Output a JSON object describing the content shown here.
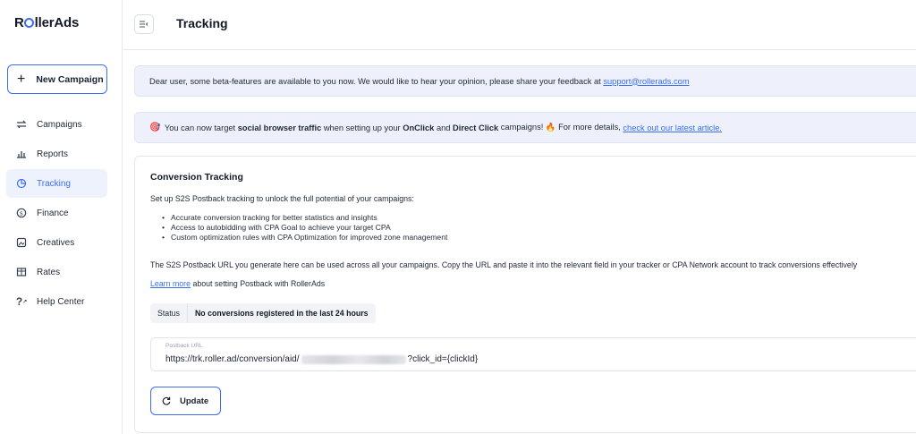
{
  "brand": {
    "logo_prefix": "R",
    "logo_suffix": "llerAds",
    "accent": "#3b6ef6"
  },
  "sidebar": {
    "new_campaign_label": "New Campaign",
    "items": [
      {
        "label": "Campaigns",
        "icon": "campaigns-icon"
      },
      {
        "label": "Reports",
        "icon": "reports-icon"
      },
      {
        "label": "Tracking",
        "icon": "tracking-icon",
        "active": true
      },
      {
        "label": "Finance",
        "icon": "finance-icon"
      },
      {
        "label": "Creatives",
        "icon": "creatives-icon"
      },
      {
        "label": "Rates",
        "icon": "rates-icon"
      },
      {
        "label": "Help Center",
        "icon": "help-icon"
      }
    ]
  },
  "header": {
    "title": "Tracking"
  },
  "banner_beta": {
    "text": "Dear user, some beta-features are available to you now. We would like to hear your opinion, please share your feedback at ",
    "link": "support@rollerads.com"
  },
  "banner_social": {
    "part1": " You can now target ",
    "bold1": "social browser traffic",
    "part2": " when setting up your ",
    "bold2": "OnClick",
    "part3": " and ",
    "bold3": "Direct Click",
    "part4": " campaigns! 🔥 For more details, ",
    "link": "check out our latest article."
  },
  "conversion": {
    "title": "Conversion Tracking",
    "intro": "Set up S2S Postback tracking to unlock the full potential of your campaigns:",
    "bullets": [
      "Accurate conversion tracking for better statistics and insights",
      "Access to autobidding with CPA Goal to achieve your target CPA",
      "Custom optimization rules with CPA Optimization for improved zone management"
    ],
    "description": "The S2S Postback URL you generate here can be used across all your campaigns. Copy the URL and paste it into the relevant field in your tracker or CPA Network account to track conversions effectively",
    "learn_more_link": "Learn more",
    "learn_more_rest": " about setting Postback with RollerAds",
    "status_label": "Status",
    "status_value": "No conversions registered in the last 24 hours",
    "postback_label": "Postback URL",
    "postback_prefix": "https://trk.roller.ad/conversion/aid/",
    "postback_suffix": "?click_id={clickId}",
    "update_label": "Update"
  }
}
